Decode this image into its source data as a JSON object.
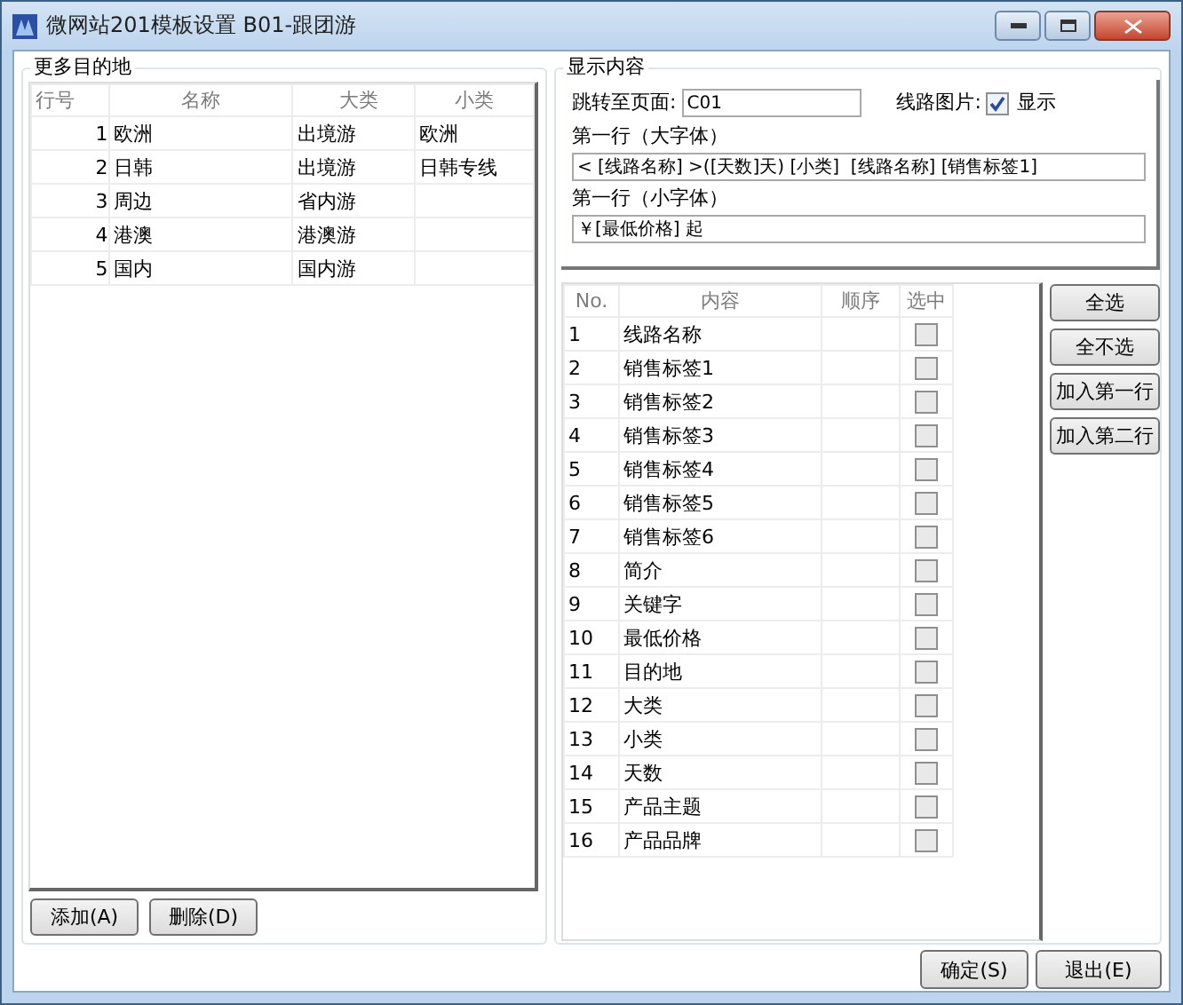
{
  "window": {
    "title": "微网站201模板设置 B01-跟团游"
  },
  "destinations": {
    "legend": "更多目的地",
    "columns": [
      "行号",
      "名称",
      "大类",
      "小类"
    ],
    "rows": [
      {
        "no": "1",
        "name": "欧洲",
        "category": "出境游",
        "subcategory": "欧洲"
      },
      {
        "no": "2",
        "name": "日韩",
        "category": "出境游",
        "subcategory": "日韩专线"
      },
      {
        "no": "3",
        "name": "周边",
        "category": "省内游"
      },
      {
        "no": "4",
        "name": "港澳",
        "category": "港澳游"
      },
      {
        "no": "5",
        "name": "国内",
        "category": "国内游"
      }
    ],
    "buttons": [
      "添加(A)",
      "删除(D)"
    ]
  },
  "display": {
    "legend": "显示内容",
    "jump_label": "跳转至页面:",
    "jump_value": "C01",
    "image_label": "线路图片:",
    "image_checkbox": {
      "label": "显示",
      "checked": true
    },
    "line1_label": "第一行（大字体）",
    "line1_value": "< [线路名称] >([天数]天) [小类]  [线路名称] [销售标签1]",
    "line2_label": "第一行（小字体）",
    "line2_value": "￥[最低价格] 起"
  },
  "fields": {
    "columns": [
      "No.",
      "内容",
      "顺序",
      "选中"
    ],
    "rows": [
      {
        "no": "1",
        "content": "线路名称",
        "checked": false
      },
      {
        "no": "2",
        "content": "销售标签1",
        "checked": false
      },
      {
        "no": "3",
        "content": "销售标签2",
        "checked": false
      },
      {
        "no": "4",
        "content": "销售标签3",
        "checked": false
      },
      {
        "no": "5",
        "content": "销售标签4",
        "checked": false
      },
      {
        "no": "6",
        "content": "销售标签5",
        "checked": false
      },
      {
        "no": "7",
        "content": "销售标签6",
        "checked": false
      },
      {
        "no": "8",
        "content": "简介",
        "checked": false
      },
      {
        "no": "9",
        "content": "关键字",
        "checked": false
      },
      {
        "no": "10",
        "content": "最低价格",
        "checked": false
      },
      {
        "no": "11",
        "content": "目的地",
        "checked": false
      },
      {
        "no": "12",
        "content": "大类",
        "checked": false
      },
      {
        "no": "13",
        "content": "小类",
        "checked": false
      },
      {
        "no": "14",
        "content": "天数",
        "checked": false
      },
      {
        "no": "15",
        "content": "产品主题",
        "checked": false
      },
      {
        "no": "16",
        "content": "产品品牌",
        "checked": false
      }
    ]
  },
  "side_buttons": [
    "全选",
    "全不选",
    "加入第一行",
    "加入第二行"
  ],
  "footer_buttons": [
    "确定(S)",
    "退出(E)"
  ]
}
